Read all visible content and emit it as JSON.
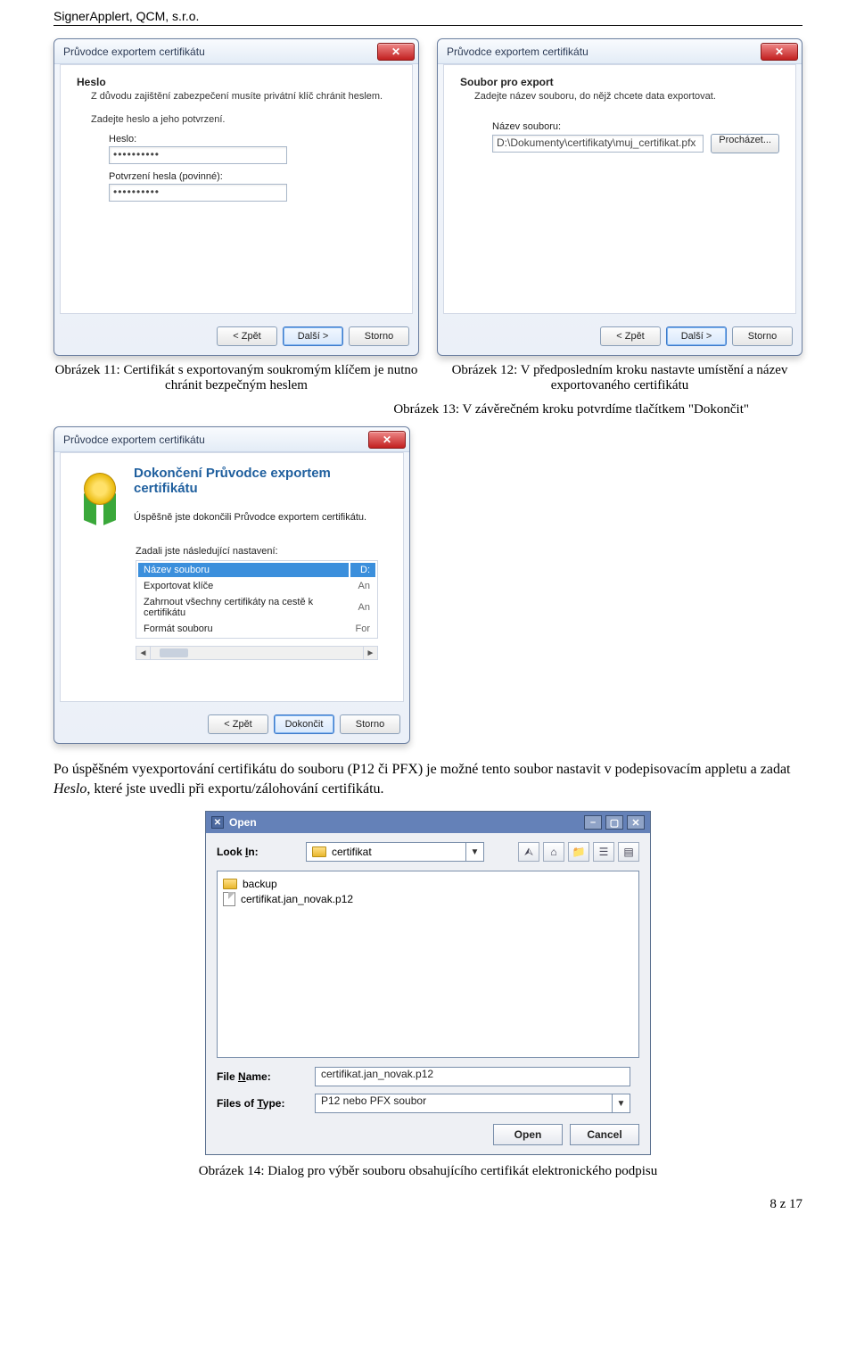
{
  "doc_header": "SignerApplert, QCM, s.r.o.",
  "dialog1": {
    "title": "Průvodce exportem certifikátu",
    "heading": "Heslo",
    "subheading": "Z důvodu zajištění zabezpečení musíte privátní klíč chránit heslem.",
    "prompt": "Zadejte heslo a jeho potvrzení.",
    "pw_label": "Heslo:",
    "pw_value": "••••••••••",
    "confirm_label": "Potvrzení hesla (povinné):",
    "confirm_value": "••••••••••",
    "back": "< Zpět",
    "next": "Další >",
    "cancel": "Storno"
  },
  "dialog2": {
    "title": "Průvodce exportem certifikátu",
    "heading": "Soubor pro export",
    "subheading": "Zadejte název souboru, do nějž chcete data exportovat.",
    "file_label": "Název souboru:",
    "file_value": "D:\\Dokumenty\\certifikaty\\muj_certifikat.pfx",
    "browse": "Procházet...",
    "back": "< Zpět",
    "next": "Další >",
    "cancel": "Storno"
  },
  "caption11": "Obrázek 11: Certifikát s exportovaným soukromým klíčem je nutno chránit bezpečným heslem",
  "caption12": "Obrázek 12: V předposledním kroku nastavte umístění a název exportovaného certifikátu",
  "caption13": "Obrázek 13: V závěrečném kroku potvrdíme tlačítkem \"Dokončit\"",
  "dialog3": {
    "title": "Průvodce exportem certifikátu",
    "comp_title": "Dokončení Průvodce exportem certifikátu",
    "comp_sub": "Úspěšně jste dokončili Průvodce exportem certifikátu.",
    "settings_label": "Zadali jste následující nastavení:",
    "col1": "Název souboru",
    "col2": "D:",
    "rows": [
      {
        "a": "Exportovat klíče",
        "b": "An"
      },
      {
        "a": "Zahrnout všechny certifikáty na cestě k certifikátu",
        "b": "An"
      },
      {
        "a": "Formát souboru",
        "b": "For"
      }
    ],
    "back": "< Zpět",
    "finish": "Dokončit",
    "cancel": "Storno"
  },
  "paragraph_1": "Po úspěšném vyexportování certifikátu do souboru (P12 či PFX) je možné tento soubor nastavit v podepisovacím appletu a zadat ",
  "paragraph_em": "Heslo",
  "paragraph_2": ", které jste uvedli při exportu/zálohování certifikátu.",
  "openDialog": {
    "title": "Open",
    "lookin_label": "Look In:",
    "lookin_value": "certifikat",
    "folder_item": "backup",
    "file_item": "certifikat.jan_novak.p12",
    "filename_label_pre": "File ",
    "filename_label_u": "N",
    "filename_label_post": "ame:",
    "filename_value": "certifikat.jan_novak.p12",
    "filetype_label_pre": "Files of ",
    "filetype_label_u": "T",
    "filetype_label_post": "ype:",
    "filetype_value": "P12 nebo PFX soubor",
    "open": "Open",
    "cancel": "Cancel"
  },
  "caption14": "Obrázek 14: Dialog pro výběr souboru obsahujícího certifikát elektronického podpisu",
  "page_number": "8 z 17"
}
